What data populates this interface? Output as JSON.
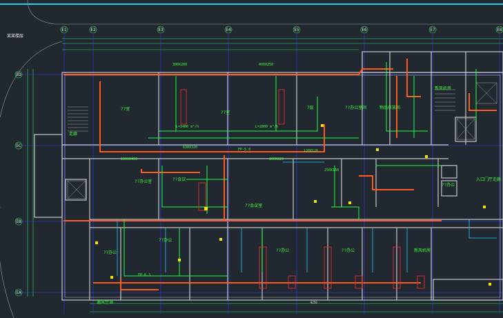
{
  "drawing": {
    "corner_title": "某某楼层",
    "colors": {
      "background": "#212830",
      "top_rule": "#22d3e6",
      "axis": "#2e3bff",
      "wall": "#c8c8c8",
      "duct_supply": "#ff5a1f",
      "duct_return": "#19ff3a",
      "dimension": "#2ee65a",
      "text": "#e8e8e8",
      "riser": "#ff2b2b",
      "accent_yellow": "#f2e600",
      "accent_cyan": "#1ec8ff"
    },
    "column_axes": [
      "E1",
      "E2",
      "E3",
      "E4",
      "E5",
      "E6",
      "E7",
      "E8"
    ],
    "row_axes": [
      "ED",
      "EC",
      "EB",
      "EA"
    ],
    "rooms": [
      {
        "label": "??室"
      },
      {
        "label": "??室"
      },
      {
        "label": "7层"
      },
      {
        "label": "??办公室间"
      },
      {
        "label": "物品存放间"
      },
      {
        "label": "新风机房"
      },
      {
        "label": "入口门厅走廊"
      },
      {
        "label": "??办公"
      },
      {
        "label": "??会议室"
      },
      {
        "label": "??办公室"
      },
      {
        "label": "??会议"
      },
      {
        "label": "??办公"
      },
      {
        "label": "??办公"
      },
      {
        "label": "??办公"
      },
      {
        "label": "??办公"
      },
      {
        "label": "新风机房"
      },
      {
        "label": "走廊"
      },
      {
        "label": "通风空调"
      }
    ],
    "notes": [
      "300X200",
      "400X250",
      "630X320",
      "L=3400 m³/h",
      "L=2800 m³/h",
      "1000X400",
      "800X320",
      "250X160",
      "120X120",
      "FP-5.0",
      "FP-6.3",
      "8250"
    ]
  }
}
